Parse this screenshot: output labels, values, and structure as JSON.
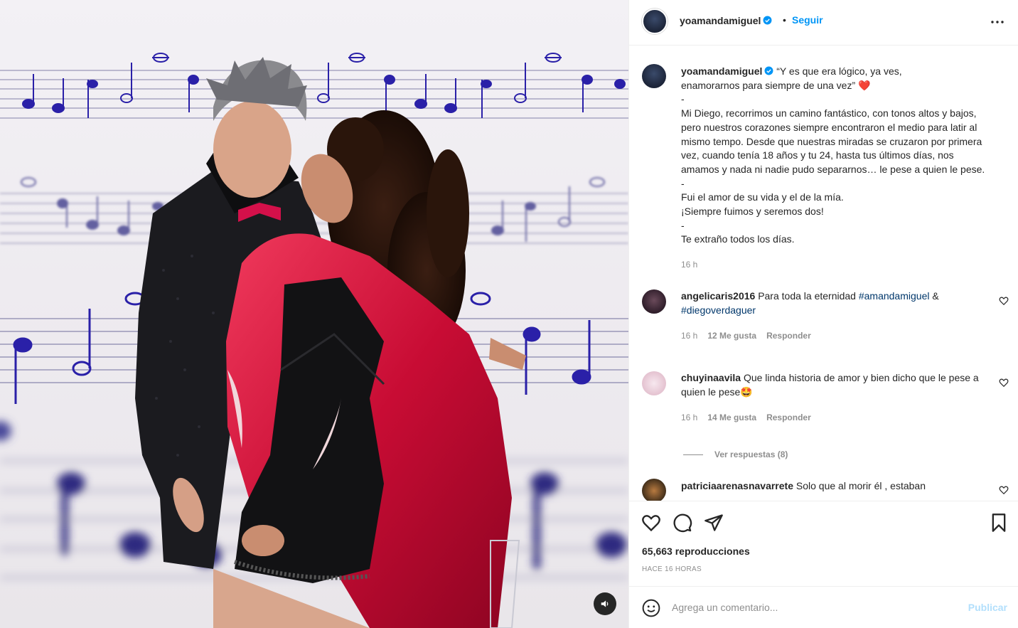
{
  "post": {
    "username": "yoamandamiguel",
    "follow_label": "Seguir",
    "separator": "•",
    "caption_lines": [
      "“Y es que era lógico, ya ves,",
      "enamorarnos para siempre de una vez” ❤️",
      "-",
      "Mi Diego, recorrimos un camino fantástico, con tonos altos y bajos,",
      "pero nuestros corazones siempre encontraron el medio para latir al",
      "mismo tempo. Desde que nuestras miradas se cruzaron por primera",
      "vez, cuando tenía 18 años y tu 24, hasta tus últimos días, nos",
      "amamos y nada ni nadie pudo separarnos… le pese a quien le pese.",
      "-",
      "Fui el amor de su vida y el de la mía.",
      "¡Siempre fuimos y seremos dos!",
      "-",
      "Te extraño todos los días."
    ],
    "caption_time": "16 h",
    "views": "65,663 reproducciones",
    "posted_ago": "HACE 16 HORAS"
  },
  "comments": [
    {
      "username": "angelicaris2016",
      "text_before": "Para toda la eternidad ",
      "tag1": "#amandamiguel",
      "text_mid": " &",
      "tag2": "#diegoverdaguer",
      "time": "16 h",
      "likes": "12 Me gusta",
      "reply": "Responder"
    },
    {
      "username": "chuyinaavila",
      "text": "Que linda historia de amor y bien dicho que le pese a quien le pese🤩",
      "time": "16 h",
      "likes": "14 Me gusta",
      "reply": "Responder",
      "view_replies": "Ver respuestas (8)"
    },
    {
      "username": "patriciaarenasnavarrete",
      "text": "Solo que al morir él , estaban"
    }
  ],
  "composer": {
    "placeholder": "Agrega un comentario...",
    "publish_label": "Publicar"
  },
  "colors": {
    "link_blue": "#0095f6",
    "tag_blue": "#00376b",
    "publish_disabled": "#b2dffc",
    "note_blue": "#2a20a8",
    "robe_red": "#d4103a"
  },
  "icons": [
    "verified-badge-icon",
    "more-options-icon",
    "heart-icon",
    "comment-icon",
    "share-icon",
    "bookmark-icon",
    "emoji-icon",
    "speaker-icon"
  ]
}
